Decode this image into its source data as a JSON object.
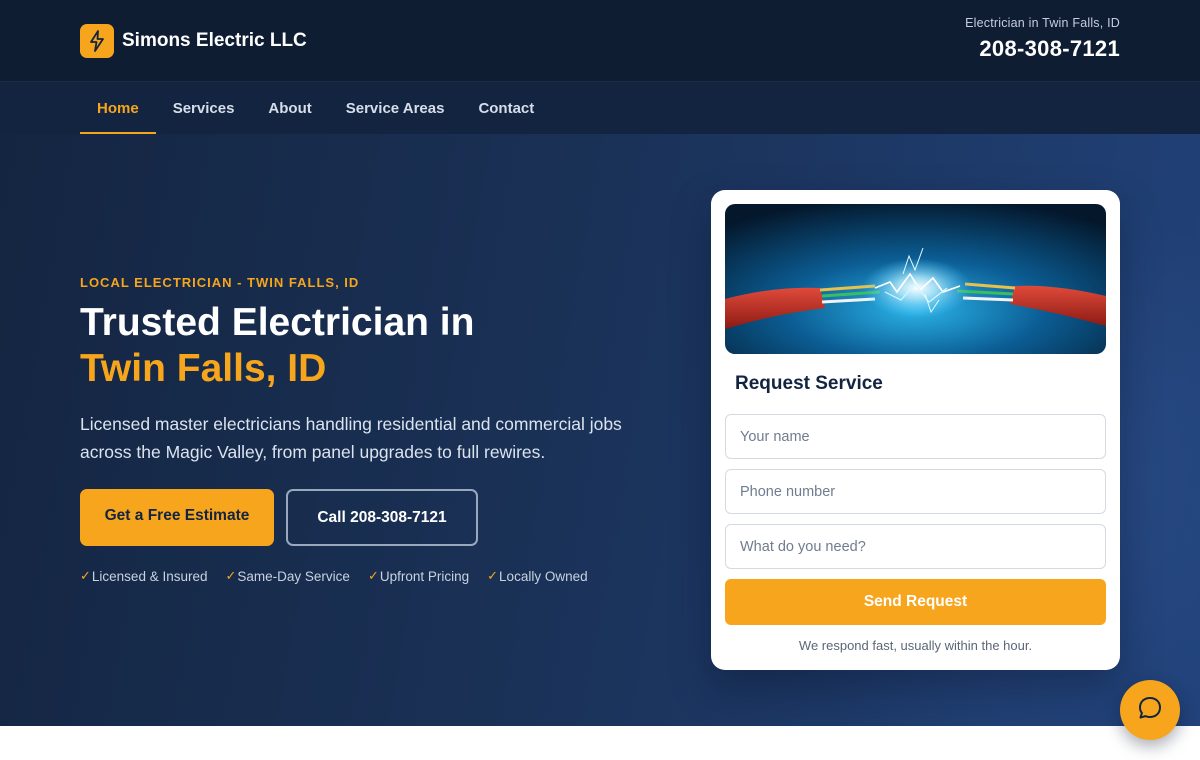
{
  "brand": {
    "name": "Simons Electric LLC",
    "logo_icon": "lightning-bolt-icon"
  },
  "header": {
    "tagline": "Electrician in Twin Falls, ID",
    "phone": "208-308-7121"
  },
  "nav": {
    "items": [
      {
        "label": "Home",
        "active": true
      },
      {
        "label": "Services",
        "active": false
      },
      {
        "label": "About",
        "active": false
      },
      {
        "label": "Service Areas",
        "active": false
      },
      {
        "label": "Contact",
        "active": false
      }
    ]
  },
  "hero": {
    "eyebrow": "LOCAL ELECTRICIAN - TWIN FALLS, ID",
    "title_line1": "Trusted Electrician in",
    "title_line2": "Twin Falls, ID",
    "subtitle": "Licensed master electricians handling residential and commercial jobs across the Magic Valley, from panel upgrades to full rewires.",
    "cta_primary": "Get a Free Estimate",
    "cta_secondary": "Call 208-308-7121",
    "trust_badges": [
      "Licensed & Insured",
      "Same-Day Service",
      "Upfront Pricing",
      "Locally Owned"
    ],
    "check_glyph": "✓"
  },
  "form": {
    "title": "Request Service",
    "fields": {
      "name_placeholder": "Your name",
      "phone_placeholder": "Phone number",
      "need_placeholder": "What do you need?"
    },
    "submit_label": "Send Request",
    "note": "We respond fast, usually within the hour."
  },
  "chat": {
    "icon": "chat-bubble-icon"
  },
  "colors": {
    "accent": "#f7a51c",
    "navy": "#132440",
    "header_bg": "#0f1d33"
  }
}
